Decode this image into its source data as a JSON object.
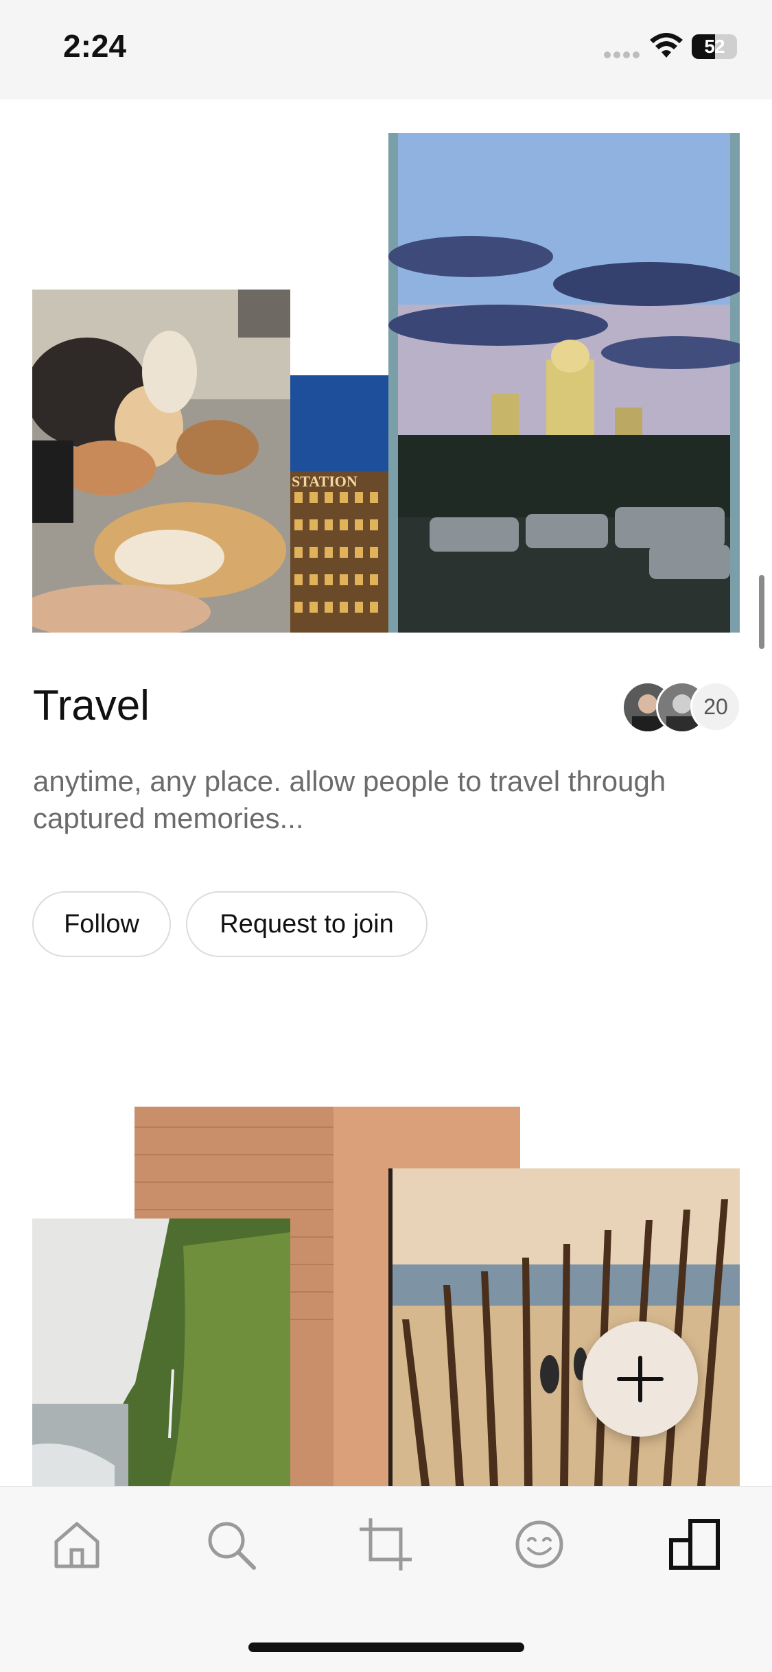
{
  "status_bar": {
    "time": "2:24",
    "battery_level": "52"
  },
  "album": {
    "title": "Travel",
    "description": "anytime, any place. allow people to travel through captured memories...",
    "member_count": "20",
    "follow_label": "Follow",
    "request_join_label": "Request to join",
    "photo_sign_text": "STATION"
  },
  "tab_bar": {
    "items": [
      {
        "icon": "home-icon",
        "active": false
      },
      {
        "icon": "search-icon",
        "active": false
      },
      {
        "icon": "crop-icon",
        "active": false
      },
      {
        "icon": "smiley-icon",
        "active": false
      },
      {
        "icon": "albums-icon",
        "active": true
      }
    ]
  },
  "fab": {
    "icon": "plus-icon"
  },
  "colors": {
    "accent_fab": "#efe6dd",
    "text_primary": "#111111",
    "text_secondary": "#6b6b6b"
  }
}
